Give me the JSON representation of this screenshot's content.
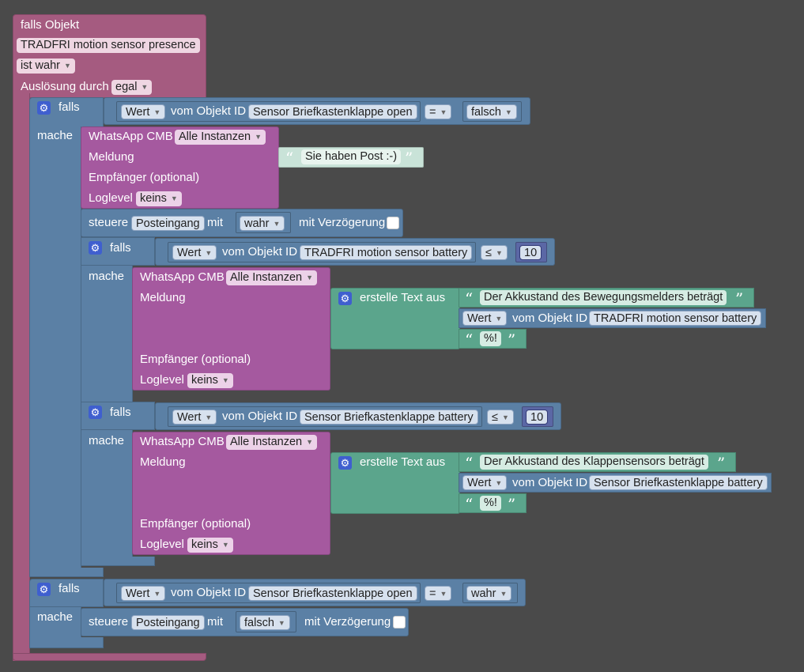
{
  "event": {
    "title": "falls Objekt",
    "object": "TRADFRI motion sensor presence",
    "condition": "ist wahr",
    "trigger_label": "Auslösung durch",
    "trigger_value": "egal"
  },
  "labels": {
    "falls": "falls",
    "mache": "mache",
    "wert": "Wert",
    "vom_objekt_id": "vom Objekt ID",
    "whatsapp": "WhatsApp CMB",
    "all_instances": "Alle Instanzen",
    "meldung": "Meldung",
    "empfaenger": "Empfänger (optional)",
    "loglevel": "Loglevel",
    "keins": "keins",
    "steuere": "steuere",
    "mit": "mit",
    "mit_verzoegerung": "mit Verzögerung",
    "erstelle_text": "erstelle Text aus",
    "open_quote": "“",
    "close_quote": "”"
  },
  "if1": {
    "object": "Sensor Briefkastenklappe open",
    "op": "=",
    "value": "falsch",
    "message": "Sie haben Post :-)",
    "control_target": "Posteingang",
    "control_value": "wahr"
  },
  "if2": {
    "object": "TRADFRI motion sensor battery",
    "op": "≤",
    "number": "10",
    "text1": "Der Akkustand des Bewegungsmelders beträgt",
    "text_object": "TRADFRI motion sensor battery",
    "text3": "%!"
  },
  "if3": {
    "object": "Sensor Briefkastenklappe battery",
    "op": "≤",
    "number": "10",
    "text1": "Der Akkustand des Klappensensors beträgt",
    "text_object": "Sensor Briefkastenklappe battery",
    "text3": "%!"
  },
  "if4": {
    "object": "Sensor Briefkastenklappe open",
    "op": "=",
    "value": "wahr",
    "control_target": "Posteingang",
    "control_value": "falsch"
  }
}
